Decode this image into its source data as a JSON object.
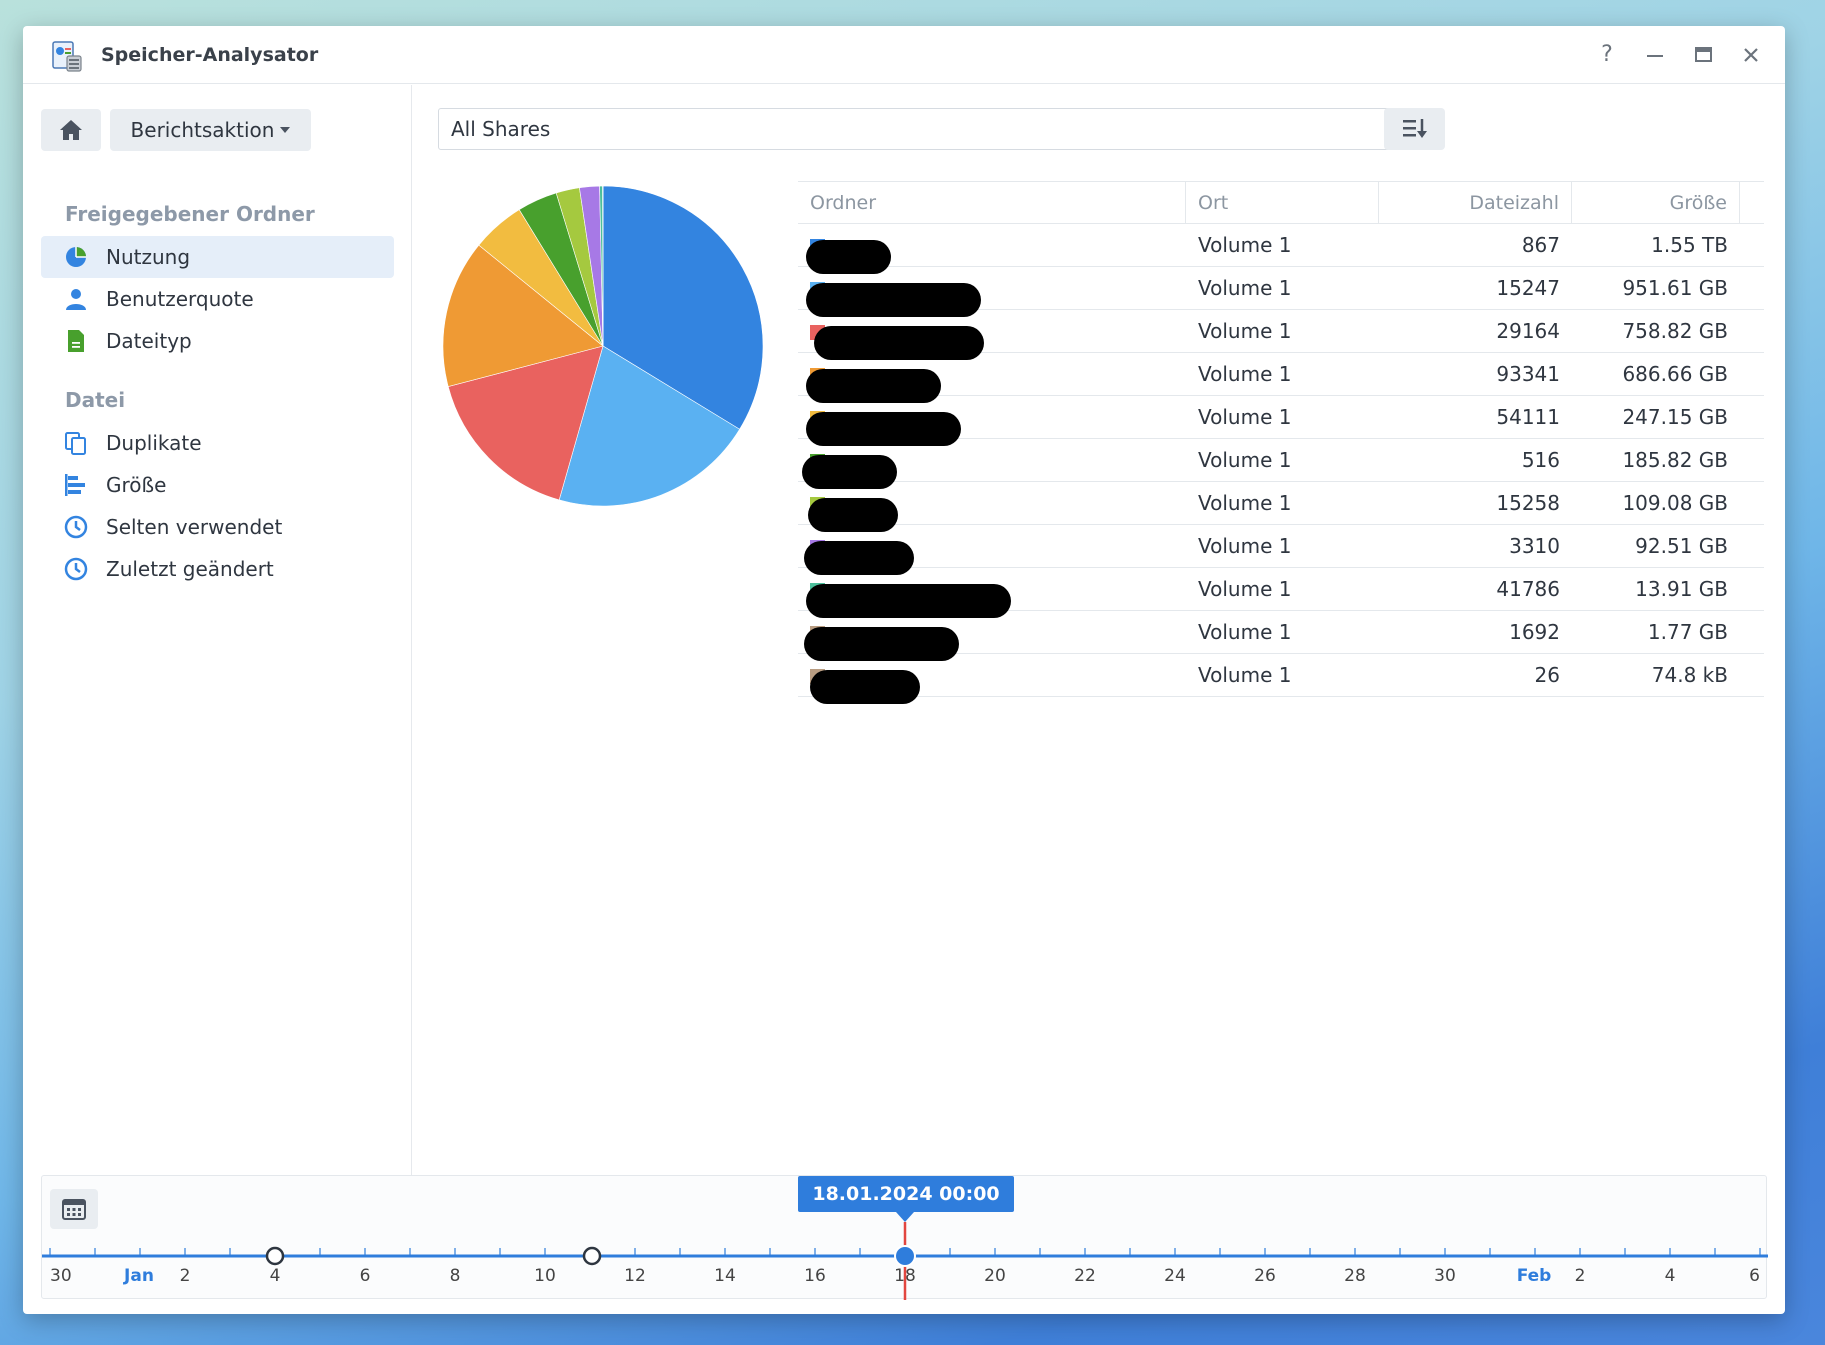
{
  "app": {
    "title": "Speicher-Analysator"
  },
  "window_controls": {
    "help": "?",
    "minimize": "—",
    "maximize": "▭",
    "close": "✕"
  },
  "toolbar": {
    "report_action_label": "Berichtsaktion"
  },
  "sidebar": {
    "section_shared": "Freigegebener Ordner",
    "items_shared": [
      {
        "label": "Nutzung",
        "icon": "pie-chart-icon",
        "active": true
      },
      {
        "label": "Benutzerquote",
        "icon": "user-icon"
      },
      {
        "label": "Dateityp",
        "icon": "file-icon"
      }
    ],
    "section_file": "Datei",
    "items_file": [
      {
        "label": "Duplikate",
        "icon": "duplicate-icon"
      },
      {
        "label": "Größe",
        "icon": "bar-size-icon"
      },
      {
        "label": "Selten verwendet",
        "icon": "clock-icon"
      },
      {
        "label": "Zuletzt geändert",
        "icon": "clock-icon"
      }
    ]
  },
  "main": {
    "share_select": "All Shares",
    "table": {
      "headers": [
        "Ordner",
        "Ort",
        "Dateizahl",
        "Größe"
      ],
      "rows": [
        {
          "color": "#3384e0",
          "location": "Volume 1",
          "count": "867",
          "size": "1.55 TB"
        },
        {
          "color": "#5ab1f2",
          "location": "Volume 1",
          "count": "15247",
          "size": "951.61 GB"
        },
        {
          "color": "#e9625f",
          "location": "Volume 1",
          "count": "29164",
          "size": "758.82 GB"
        },
        {
          "color": "#ef9a34",
          "location": "Volume 1",
          "count": "93341",
          "size": "686.66 GB"
        },
        {
          "color": "#f2bc40",
          "location": "Volume 1",
          "count": "54111",
          "size": "247.15 GB"
        },
        {
          "color": "#48a02d",
          "location": "Volume 1",
          "count": "516",
          "size": "185.82 GB"
        },
        {
          "color": "#a5c93f",
          "location": "Volume 1",
          "count": "15258",
          "size": "109.08 GB"
        },
        {
          "color": "#a779e6",
          "location": "Volume 1",
          "count": "3310",
          "size": "92.51 GB"
        },
        {
          "color": "#4cbf9b",
          "location": "Volume 1",
          "count": "41786",
          "size": "13.91 GB"
        },
        {
          "color": "#b99d82",
          "location": "Volume 1",
          "count": "1692",
          "size": "1.77 GB"
        },
        {
          "color": "#b99d82",
          "location": "Volume 1",
          "count": "26",
          "size": "74.8 kB"
        }
      ]
    }
  },
  "chart_data": {
    "type": "pie",
    "values": [
      1550,
      951.61,
      758.82,
      686.66,
      247.15,
      185.82,
      109.08,
      92.51,
      13.91,
      1.77,
      7.48e-05
    ],
    "colors": [
      "#3384e0",
      "#5ab1f2",
      "#e9625f",
      "#ef9a34",
      "#f2bc40",
      "#48a02d",
      "#a5c93f",
      "#a779e6",
      "#4cbf9b",
      "#b99d82",
      "#b99d82"
    ],
    "unit": "GB"
  },
  "timeline": {
    "selected_label": "18.01.2024 00:00",
    "ticks": [
      "30",
      "Jan",
      "2",
      "4",
      "6",
      "8",
      "10",
      "12",
      "14",
      "16",
      "18",
      "20",
      "22",
      "24",
      "26",
      "28",
      "30",
      "Feb",
      "2",
      "4",
      "6"
    ],
    "month_ticks": [
      "Jan",
      "Feb"
    ]
  }
}
